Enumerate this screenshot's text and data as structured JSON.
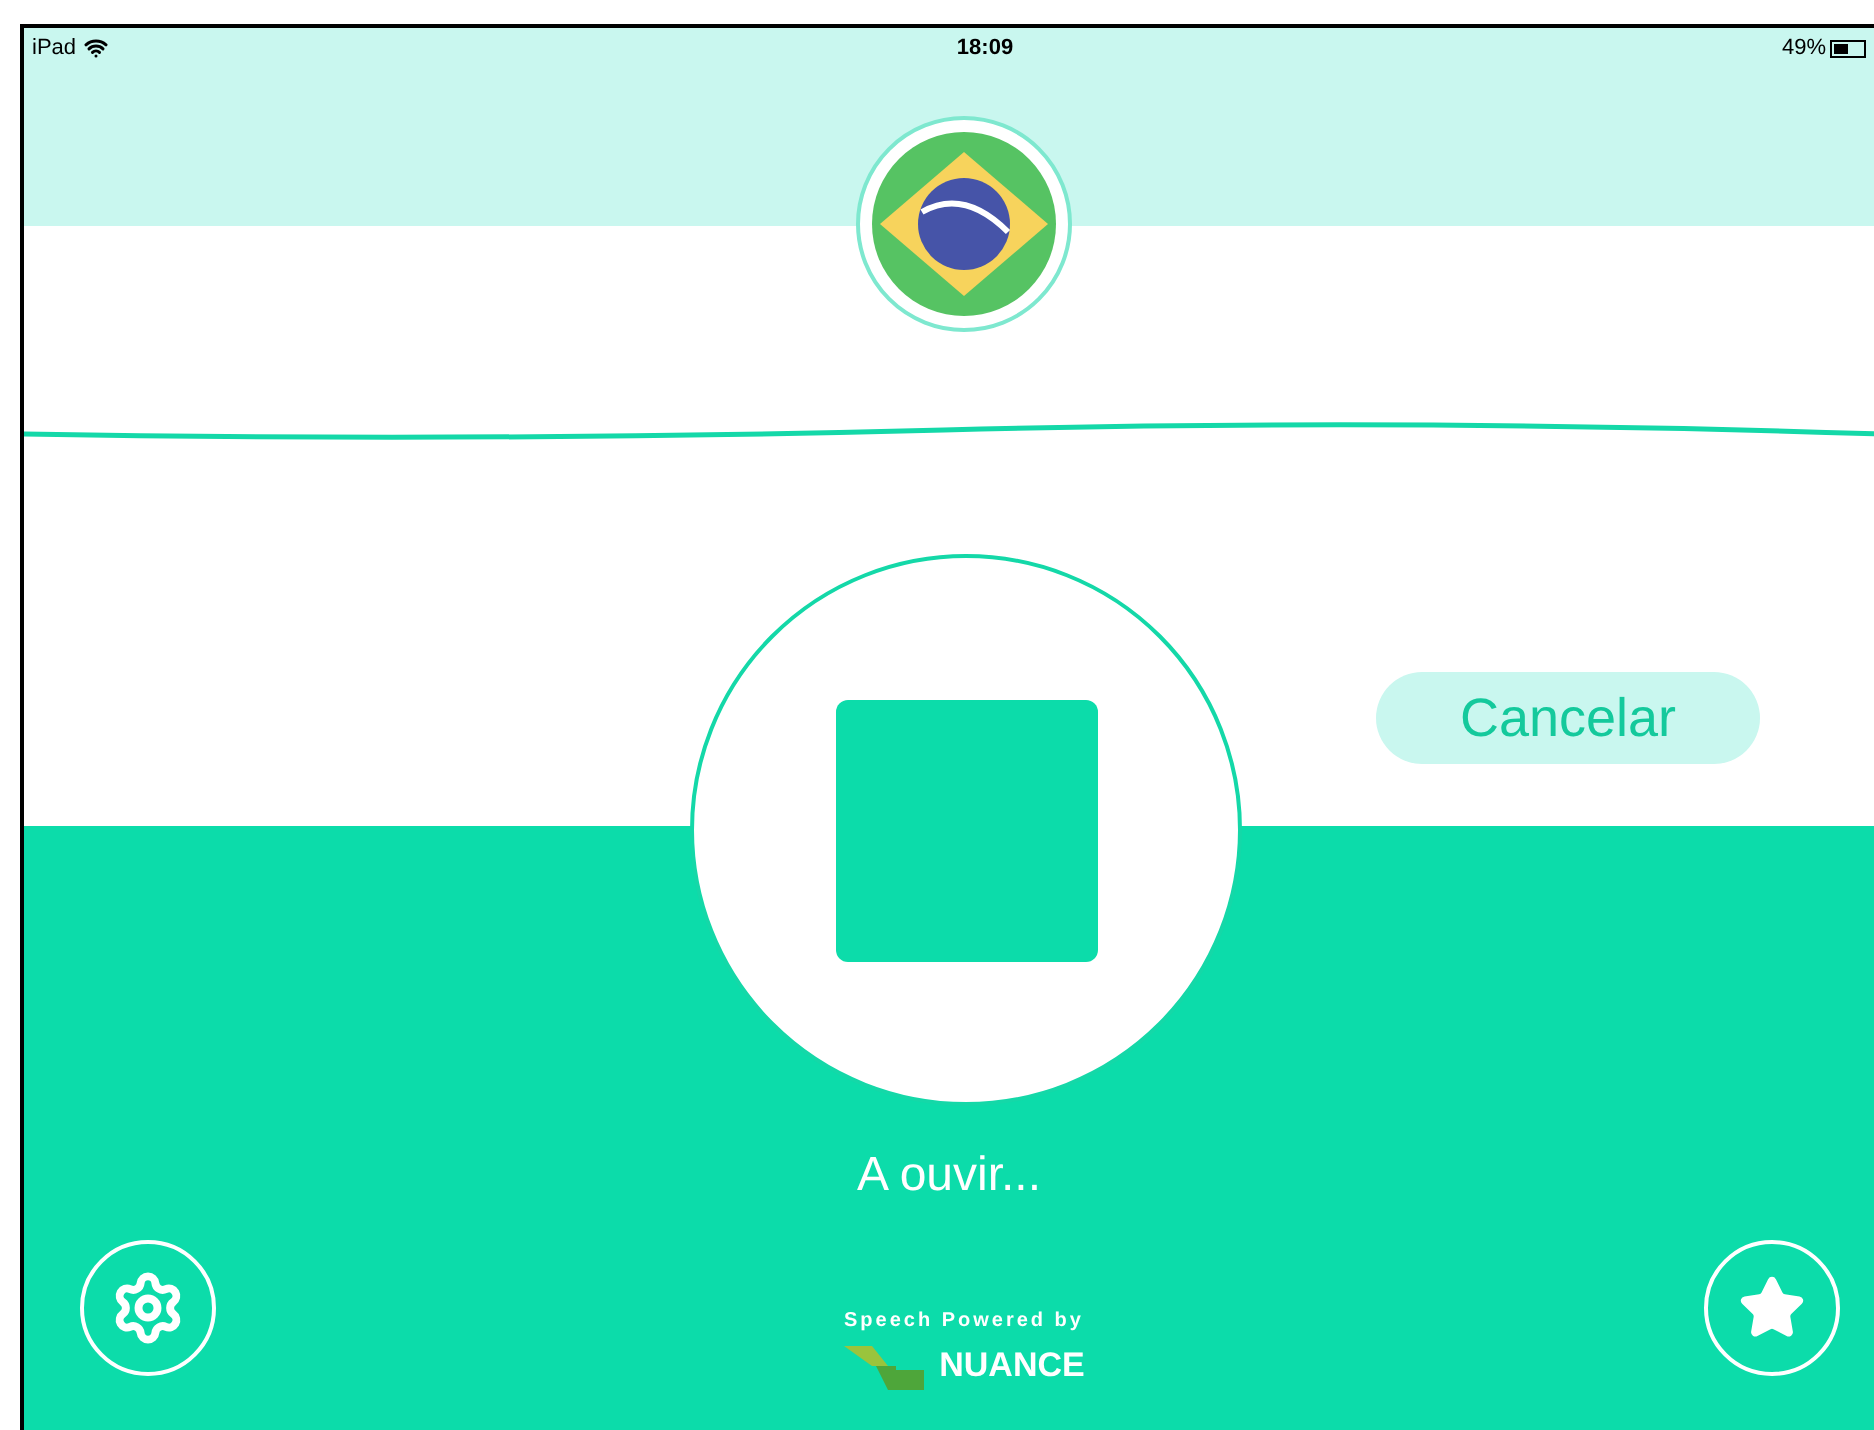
{
  "status_bar": {
    "device": "iPad",
    "time": "18:09",
    "battery": "49%"
  },
  "cancel_button": {
    "label": "Cancelar"
  },
  "status_text": "A ouvir...",
  "footer": {
    "powered_by": "Speech Powered by",
    "brand": "NUANCE"
  }
}
